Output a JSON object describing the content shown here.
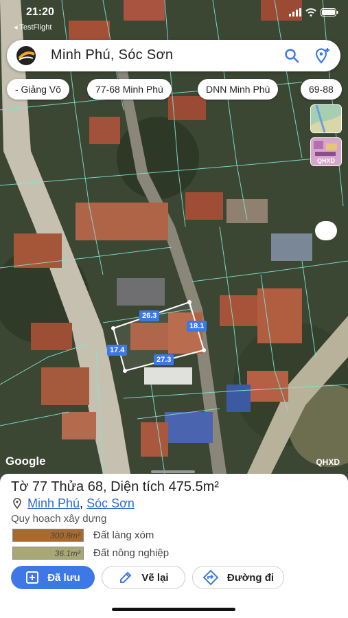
{
  "status_bar": {
    "time": "21:20",
    "back_app": "◂ TestFlight"
  },
  "search": {
    "title": "Minh Phú, Sóc Sơn"
  },
  "chips": [
    "- Giảng Võ",
    "77-68 Minh Phú",
    "DNN Minh Phú",
    "69-88"
  ],
  "layers": {
    "qhxd_label": "QHXD"
  },
  "map": {
    "google_label": "Google",
    "corner_label": "QHXD",
    "measurements": [
      "26.3",
      "18.1",
      "17.4",
      "27.3"
    ]
  },
  "sheet": {
    "title": "Tờ 77 Thửa 68, Diện tích 475.5m²",
    "location": {
      "ward": "Minh Phú",
      "separator": ", ",
      "district": "Sóc Sơn"
    },
    "planning_title": "Quy hoạch xây dựng",
    "legend": [
      {
        "area": "300.8m²",
        "label": "Đất làng xóm",
        "color": "#a86b2f"
      },
      {
        "area": "36.1m²",
        "label": "Đất nông nghiệp",
        "color": "#a8a874"
      }
    ],
    "actions": {
      "saved": "Đã lưu",
      "redraw": "Vẽ lại",
      "directions": "Đường đi"
    }
  },
  "colors": {
    "accent": "#3d78e6",
    "parcel_lines": "#7fe6d6"
  }
}
